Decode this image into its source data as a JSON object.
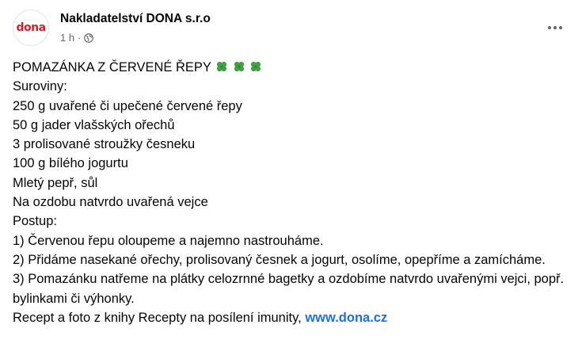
{
  "post": {
    "author": {
      "name": "Nakladatelství DONA s.r.o",
      "avatar_text": "dona",
      "avatar_icon": "dona-logo-icon"
    },
    "meta": {
      "time": "1 h",
      "separator": "·",
      "audience_icon": "globe-icon"
    },
    "more_icon": "more-options-icon",
    "title": "POMAZÁNKA Z ČERVENÉ ŘEPY",
    "title_emoji_icon": "four-leaf-clover-icon",
    "lines": [
      "Suroviny:",
      "250 g uvařené či upečené červené řepy",
      "50 g jader vlašských ořechů",
      "3 prolisované stroužky česneku",
      "100 g bílého jogurtu",
      "Mletý pepř, sůl",
      "Na ozdobu natvrdo uvařená vejce",
      "Postup:",
      "1) Červenou řepu oloupeme a najemno nastrouháme.",
      "2) Přidáme nasekané ořechy, prolisovaný česnek a jogurt, osolíme, opepříme a zamícháme.",
      "3) Pomazánku natřeme na plátky celozrnné bagetky a ozdobíme natvrdo uvařenými vejci, popř. bylinkami či výhonky."
    ],
    "footer_text": "Recept a foto z knihy Recepty na posílení imunity,",
    "footer_link": "www.dona.cz"
  },
  "colors": {
    "brand": "#d01f2a",
    "link": "#216fdb",
    "meta": "#65676b",
    "clover": "#43a047"
  }
}
